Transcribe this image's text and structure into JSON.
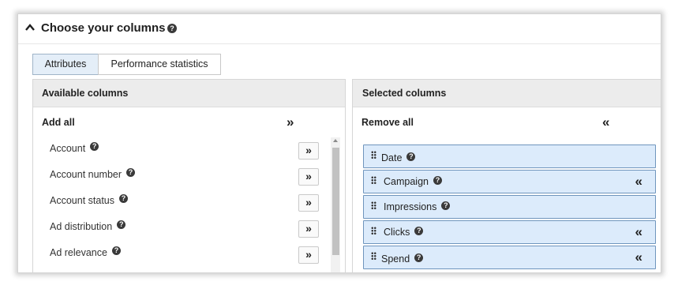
{
  "header": {
    "title": "Choose your columns",
    "collapse_icon": "chevron-up-icon",
    "help_icon": "help-icon",
    "help_glyph": "?"
  },
  "tabs": [
    {
      "label": "Attributes",
      "active": true
    },
    {
      "label": "Performance statistics",
      "active": false
    }
  ],
  "available": {
    "title": "Available columns",
    "add_all_label": "Add all",
    "add_glyph": "»",
    "items": [
      {
        "label": "Account"
      },
      {
        "label": "Account number"
      },
      {
        "label": "Account status"
      },
      {
        "label": "Ad distribution"
      },
      {
        "label": "Ad relevance"
      }
    ]
  },
  "selected": {
    "title": "Selected columns",
    "remove_all_label": "Remove all",
    "remove_glyph": "«",
    "items": [
      {
        "label": "Date",
        "removable": false
      },
      {
        "label": "Campaign",
        "removable": true
      },
      {
        "label": "Impressions",
        "removable": false
      },
      {
        "label": "Clicks",
        "removable": true
      },
      {
        "label": "Spend",
        "removable": true
      }
    ]
  },
  "colors": {
    "active_tab_bg": "#e4eef8",
    "selected_item_bg": "#dcebfb",
    "selected_item_border": "#6f95bd",
    "panel_header_bg": "#ececec"
  }
}
